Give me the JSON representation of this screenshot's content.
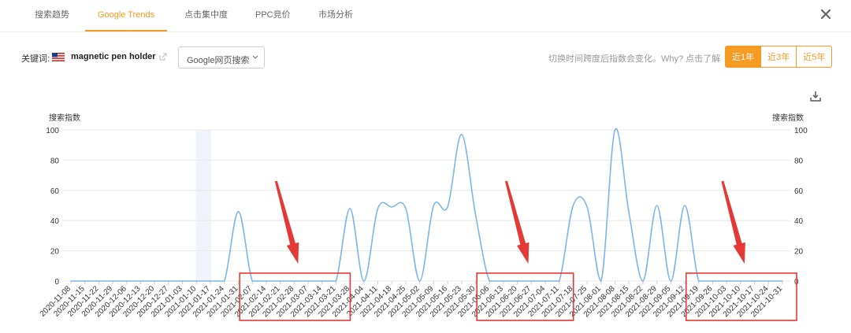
{
  "tabs": [
    {
      "label": "搜索趋势",
      "active": false
    },
    {
      "label": "Google Trends",
      "active": true
    },
    {
      "label": "点击集中度",
      "active": false
    },
    {
      "label": "PPC竞价",
      "active": false
    },
    {
      "label": "市场分析",
      "active": false
    }
  ],
  "keyword": {
    "label": "关键词:",
    "flag_icon": "us-flag-icon",
    "text": "magnetic pen holder"
  },
  "source_select": {
    "value": "Google网页搜索"
  },
  "hint_text": "切换时间跨度后指数会变化。Why? 点击了解",
  "range_buttons": [
    {
      "label": "近1年",
      "active": true
    },
    {
      "label": "近3年",
      "active": false
    },
    {
      "label": "近5年",
      "active": false
    }
  ],
  "colors": {
    "accent": "#f59a23",
    "line": "#7cb5ec",
    "annotation": "#e53935"
  },
  "chart_data": {
    "type": "line",
    "ylabel_left": "搜索指数",
    "ylabel_right": "搜索指数",
    "ylim": [
      0,
      100
    ],
    "yticks": [
      0,
      20,
      40,
      60,
      80,
      100
    ],
    "x": [
      "2020-11-08",
      "2020-11-15",
      "2020-11-22",
      "2020-11-29",
      "2020-12-06",
      "2020-12-13",
      "2020-12-20",
      "2020-12-27",
      "2021-01-03",
      "2021-01-10",
      "2021-01-17",
      "2021-01-24",
      "2021-01-31",
      "2021-02-07",
      "2021-02-14",
      "2021-02-21",
      "2021-02-28",
      "2021-03-07",
      "2021-03-14",
      "2021-03-21",
      "2021-03-28",
      "2021-04-04",
      "2021-04-11",
      "2021-04-18",
      "2021-04-25",
      "2021-05-02",
      "2021-05-09",
      "2021-05-16",
      "2021-05-23",
      "2021-05-30",
      "2021-06-06",
      "2021-06-13",
      "2021-06-20",
      "2021-06-27",
      "2021-07-04",
      "2021-07-11",
      "2021-07-18",
      "2021-07-25",
      "2021-08-01",
      "2021-08-08",
      "2021-08-15",
      "2021-08-22",
      "2021-08-29",
      "2021-09-05",
      "2021-09-12",
      "2021-09-19",
      "2021-09-26",
      "2021-10-03",
      "2021-10-10",
      "2021-10-17",
      "2021-10-24",
      "2021-10-31"
    ],
    "series": [
      {
        "values": [
          0,
          0,
          0,
          0,
          0,
          0,
          0,
          0,
          0,
          0,
          0,
          0,
          46,
          0,
          0,
          0,
          0,
          0,
          0,
          0,
          48,
          0,
          48,
          49,
          48,
          0,
          50,
          49,
          97,
          44,
          0,
          0,
          0,
          0,
          0,
          0,
          50,
          49,
          0,
          100,
          45,
          0,
          50,
          0,
          50,
          0,
          0,
          0,
          0,
          0,
          0,
          0
        ]
      }
    ],
    "grid": true,
    "highlight_band_category": "2021-01-10",
    "annotations": [
      {
        "type": "box-with-arrow",
        "from": "2021-02-07",
        "to": "2021-03-21"
      },
      {
        "type": "box-with-arrow",
        "from": "2021-06-06",
        "to": "2021-07-11"
      },
      {
        "type": "box-with-arrow",
        "from": "2021-09-19",
        "to": "2021-10-31"
      }
    ]
  }
}
